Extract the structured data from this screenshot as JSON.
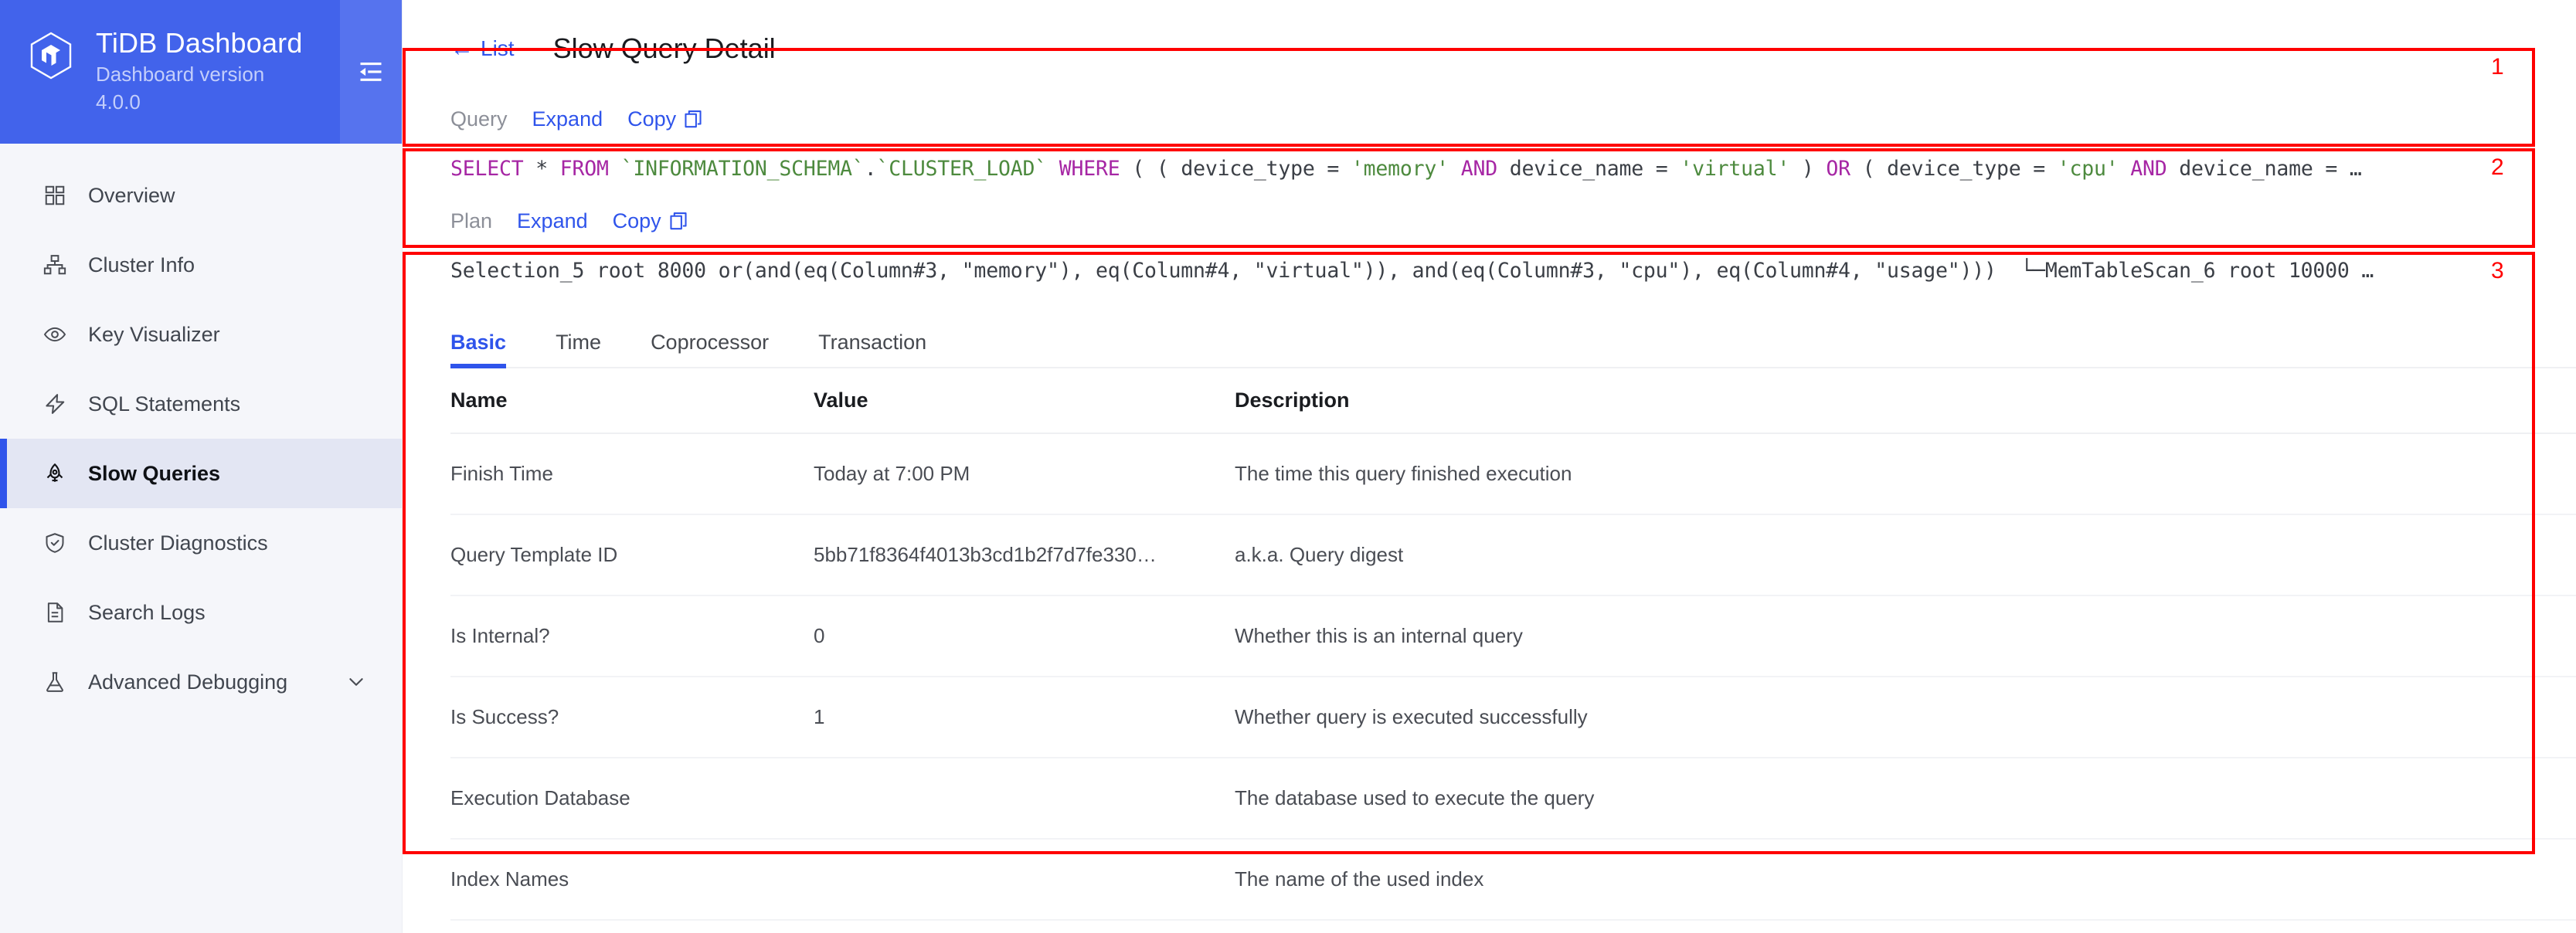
{
  "brand": {
    "title": "TiDB Dashboard",
    "subtitle": "Dashboard version 4.0.0",
    "logo_icon": "tidb-hexagon-logo",
    "collapse_icon": "menu-collapse-icon"
  },
  "sidebar": {
    "items": [
      {
        "label": "Overview",
        "icon": "grid-icon",
        "active": false
      },
      {
        "label": "Cluster Info",
        "icon": "cluster-nodes-icon",
        "active": false
      },
      {
        "label": "Key Visualizer",
        "icon": "eye-icon",
        "active": false
      },
      {
        "label": "SQL Statements",
        "icon": "lightning-icon",
        "active": false
      },
      {
        "label": "Slow Queries",
        "icon": "rocket-icon",
        "active": true
      },
      {
        "label": "Cluster Diagnostics",
        "icon": "shield-check-icon",
        "active": false
      },
      {
        "label": "Search Logs",
        "icon": "file-lines-icon",
        "active": false
      },
      {
        "label": "Advanced Debugging",
        "icon": "flask-icon",
        "active": false,
        "chevron": "chevron-down-icon"
      }
    ]
  },
  "header": {
    "back_label": "List",
    "back_icon": "arrow-left-icon",
    "title": "Slow Query Detail"
  },
  "query_panel": {
    "label": "Query",
    "expand_label": "Expand",
    "copy_label": "Copy",
    "copy_icon": "copy-icon",
    "sql_tokens": [
      {
        "t": "SELECT",
        "c": "kw"
      },
      {
        "t": " * ",
        "c": "pun"
      },
      {
        "t": "FROM",
        "c": "kw"
      },
      {
        "t": " ",
        "c": "pun"
      },
      {
        "t": "`INFORMATION_SCHEMA`",
        "c": "tbl"
      },
      {
        "t": ".",
        "c": "pun"
      },
      {
        "t": "`CLUSTER_LOAD`",
        "c": "tbl"
      },
      {
        "t": " ",
        "c": "pun"
      },
      {
        "t": "WHERE",
        "c": "kw"
      },
      {
        "t": " ( ( device_type = ",
        "c": "pun"
      },
      {
        "t": "'memory'",
        "c": "str"
      },
      {
        "t": " ",
        "c": "pun"
      },
      {
        "t": "AND",
        "c": "kw"
      },
      {
        "t": " device_name = ",
        "c": "pun"
      },
      {
        "t": "'virtual'",
        "c": "str"
      },
      {
        "t": " ) ",
        "c": "pun"
      },
      {
        "t": "OR",
        "c": "kw"
      },
      {
        "t": " ( device_type = ",
        "c": "pun"
      },
      {
        "t": "'cpu'",
        "c": "str"
      },
      {
        "t": " ",
        "c": "pun"
      },
      {
        "t": "AND",
        "c": "kw"
      },
      {
        "t": " device_name = …",
        "c": "pun"
      }
    ]
  },
  "plan_panel": {
    "label": "Plan",
    "expand_label": "Expand",
    "copy_label": "Copy",
    "copy_icon": "copy-icon",
    "text": "Selection_5 root 8000 or(and(eq(Column#3, \"memory\"), eq(Column#4, \"virtual\")), and(eq(Column#3, \"cpu\"), eq(Column#4, \"usage\")))  └─MemTableScan_6 root 10000 …"
  },
  "tabs": [
    {
      "label": "Basic",
      "active": true
    },
    {
      "label": "Time",
      "active": false
    },
    {
      "label": "Coprocessor",
      "active": false
    },
    {
      "label": "Transaction",
      "active": false
    }
  ],
  "table": {
    "columns": [
      "Name",
      "Value",
      "Description"
    ],
    "rows": [
      {
        "name": "Finish Time",
        "value": "Today at 7:00 PM",
        "description": "The time this query finished execution"
      },
      {
        "name": "Query Template ID",
        "value": "5bb71f8364f4013b3cd1b2f7d7fe330…",
        "description": "a.k.a. Query digest"
      },
      {
        "name": "Is Internal?",
        "value": "0",
        "description": "Whether this is an internal query"
      },
      {
        "name": "Is Success?",
        "value": "1",
        "description": "Whether query is executed successfully"
      },
      {
        "name": "Execution Database",
        "value": "",
        "description": "The database used to execute the query"
      },
      {
        "name": "Index Names",
        "value": "",
        "description": "The name of the used index"
      }
    ]
  },
  "annotations": [
    {
      "number": "1"
    },
    {
      "number": "2"
    },
    {
      "number": "3"
    }
  ],
  "colors": {
    "brand_blue": "#4263eb",
    "accent_blue": "#2f54eb",
    "annotation_red": "#ff0000",
    "sidebar_bg": "#f5f6fa",
    "active_item_bg": "#e3e6f3"
  }
}
